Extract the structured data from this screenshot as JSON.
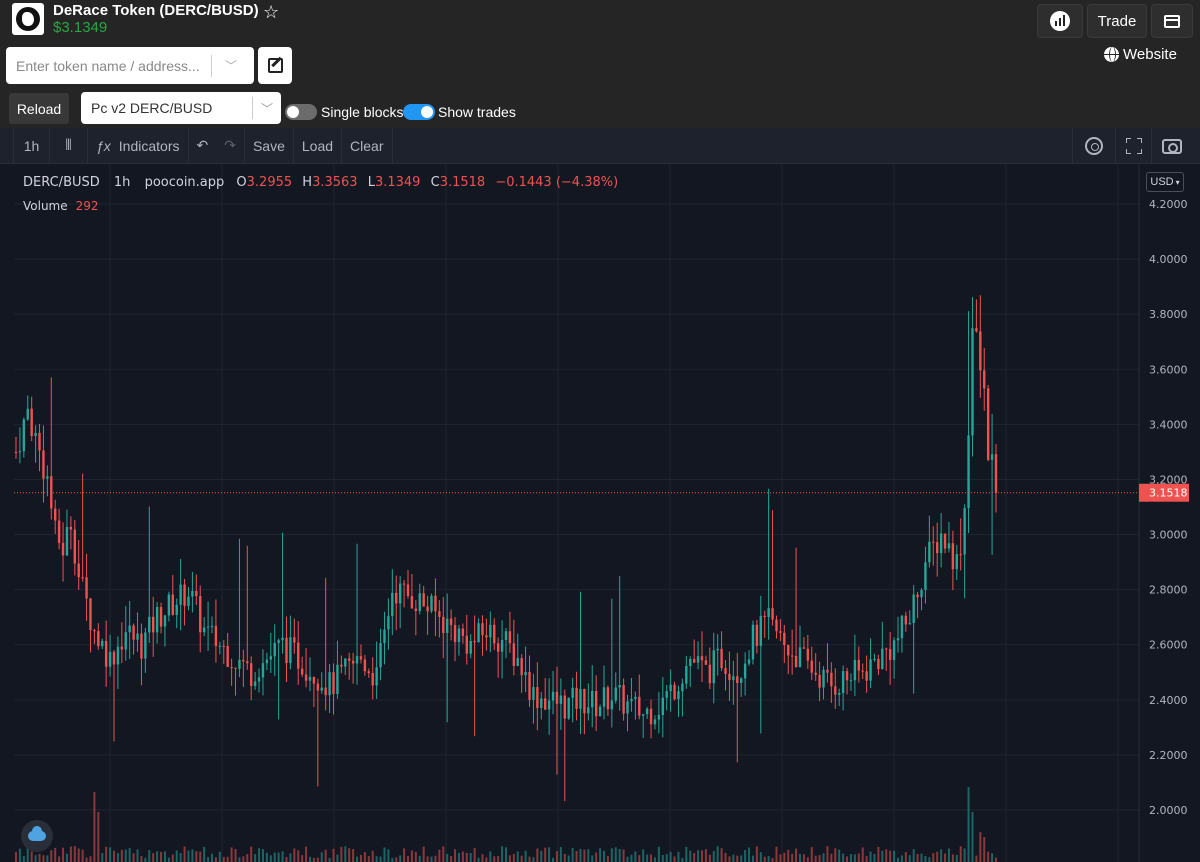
{
  "header": {
    "token_title": "DeRace Token (DERC/BUSD)",
    "price": "$3.1349",
    "trade_label": "Trade",
    "website_label": "Website",
    "search_placeholder": "Enter token name / address...",
    "reload_label": "Reload",
    "pair_selected": "Pc v2 DERC/BUSD",
    "single_blocks_label": "Single blocks",
    "show_trades_label": "Show trades",
    "single_blocks_on": false,
    "show_trades_on": true
  },
  "toolbar": {
    "interval": "1h",
    "indicators": "Indicators",
    "save": "Save",
    "load": "Load",
    "clear": "Clear"
  },
  "legend": {
    "symbol": "DERC/BUSD",
    "interval": "1h",
    "source": "poocoin.app",
    "o_label": "O",
    "o": "3.2955",
    "h_label": "H",
    "h": "3.3563",
    "l_label": "L",
    "l": "3.1349",
    "c_label": "C",
    "c": "3.1518",
    "change": "−0.1443 (−4.38%)",
    "volume_label": "Volume",
    "volume": "292"
  },
  "currency": "USD",
  "colors": {
    "up": "#26a69a",
    "down": "#ef5350",
    "background": "#131722",
    "grid": "#1f2430",
    "accent": "#2196f3",
    "price_green": "#28a745"
  },
  "chart_data": {
    "type": "candlestick",
    "ylim": [
      1.9,
      4.25
    ],
    "yticks": [
      "4.2000",
      "4.0000",
      "3.8000",
      "3.6000",
      "3.4000",
      "3.2000",
      "3.0000",
      "2.8000",
      "2.6000",
      "2.4000",
      "2.2000",
      "2.0000"
    ],
    "ytick_values": [
      4.2,
      4.0,
      3.8,
      3.6,
      3.4,
      3.2,
      3.0,
      2.8,
      2.6,
      2.4,
      2.2,
      2.0
    ],
    "last_price": 3.1518,
    "last_price_label": "3.1518",
    "anchors": [
      [
        0,
        3.3
      ],
      [
        3,
        3.45
      ],
      [
        5,
        3.35
      ],
      [
        8,
        3.2
      ],
      [
        10,
        3.0
      ],
      [
        12,
        2.95
      ],
      [
        14,
        3.05
      ],
      [
        16,
        2.85
      ],
      [
        18,
        2.75
      ],
      [
        20,
        2.65
      ],
      [
        24,
        2.55
      ],
      [
        28,
        2.65
      ],
      [
        32,
        2.6
      ],
      [
        36,
        2.7
      ],
      [
        40,
        2.75
      ],
      [
        44,
        2.8
      ],
      [
        48,
        2.65
      ],
      [
        52,
        2.6
      ],
      [
        56,
        2.55
      ],
      [
        60,
        2.5
      ],
      [
        64,
        2.55
      ],
      [
        68,
        2.6
      ],
      [
        72,
        2.55
      ],
      [
        76,
        2.5
      ],
      [
        80,
        2.45
      ],
      [
        84,
        2.5
      ],
      [
        88,
        2.55
      ],
      [
        92,
        2.48
      ],
      [
        96,
        2.8
      ],
      [
        100,
        2.78
      ],
      [
        104,
        2.75
      ],
      [
        108,
        2.7
      ],
      [
        112,
        2.65
      ],
      [
        116,
        2.6
      ],
      [
        120,
        2.65
      ],
      [
        124,
        2.62
      ],
      [
        128,
        2.55
      ],
      [
        132,
        2.42
      ],
      [
        136,
        2.4
      ],
      [
        140,
        2.38
      ],
      [
        144,
        2.4
      ],
      [
        148,
        2.38
      ],
      [
        152,
        2.42
      ],
      [
        156,
        2.38
      ],
      [
        160,
        2.35
      ],
      [
        164,
        2.38
      ],
      [
        168,
        2.45
      ],
      [
        172,
        2.55
      ],
      [
        176,
        2.5
      ],
      [
        180,
        2.55
      ],
      [
        184,
        2.5
      ],
      [
        188,
        2.62
      ],
      [
        192,
        2.68
      ],
      [
        196,
        2.6
      ],
      [
        200,
        2.55
      ],
      [
        204,
        2.5
      ],
      [
        208,
        2.45
      ],
      [
        212,
        2.48
      ],
      [
        216,
        2.5
      ],
      [
        220,
        2.55
      ],
      [
        224,
        2.6
      ],
      [
        228,
        2.7
      ],
      [
        232,
        2.9
      ],
      [
        236,
        3.0
      ],
      [
        240,
        2.9
      ],
      [
        242,
        3.1
      ],
      [
        244,
        3.75
      ],
      [
        246,
        3.6
      ],
      [
        248,
        3.35
      ],
      [
        250,
        3.15
      ]
    ],
    "count": 251,
    "volume_spikes": [
      [
        20,
        0.7
      ],
      [
        21,
        0.5
      ],
      [
        243,
        0.75
      ],
      [
        244,
        0.5
      ],
      [
        246,
        0.3
      ],
      [
        247,
        0.25
      ]
    ]
  }
}
